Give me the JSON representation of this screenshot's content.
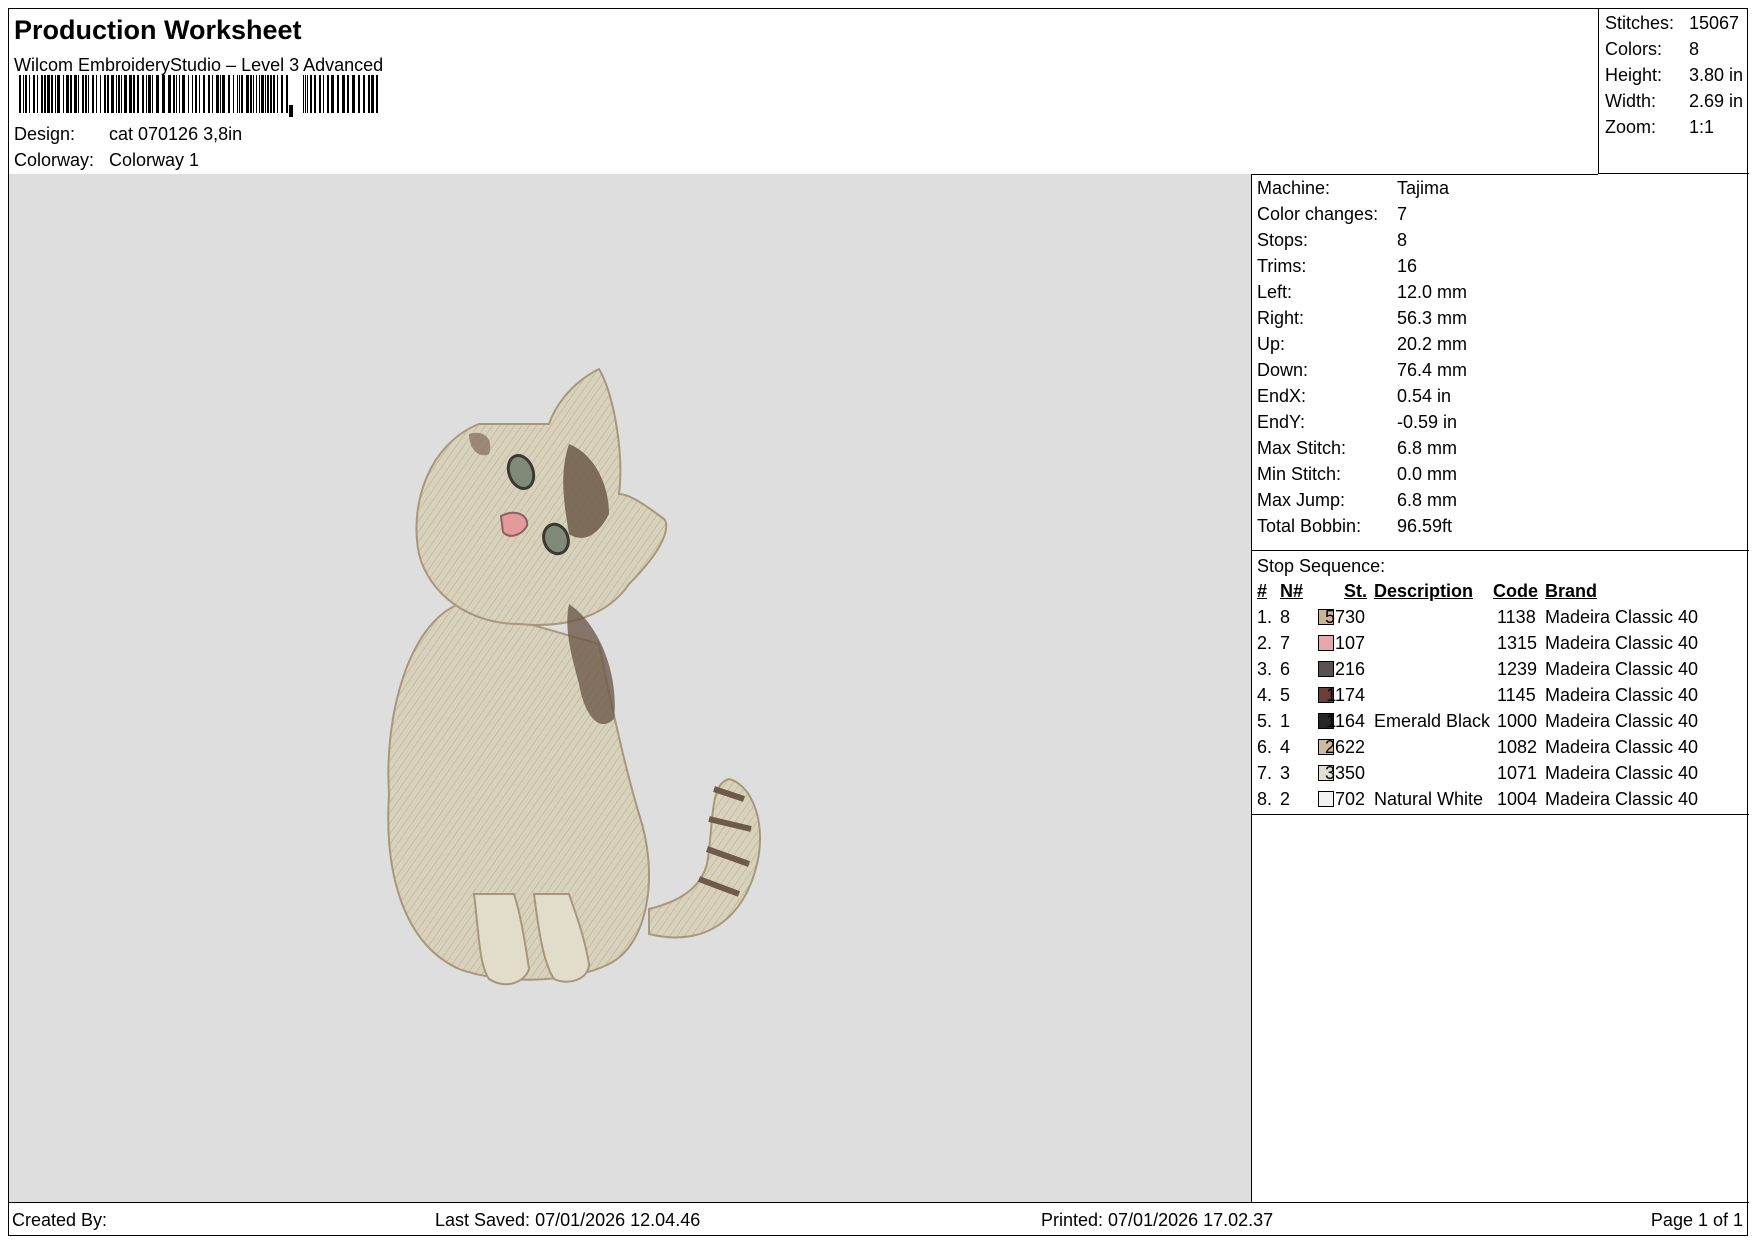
{
  "header": {
    "title": "Production Worksheet",
    "subtitle": "Wilcom EmbroideryStudio – Level 3 Advanced",
    "design_label": "Design:",
    "design_value": "cat 070126 3,8in",
    "colorway_label": "Colorway:",
    "colorway_value": "Colorway 1"
  },
  "summary": [
    {
      "label": "Stitches:",
      "value": "15067"
    },
    {
      "label": "Colors:",
      "value": "8"
    },
    {
      "label": "Height:",
      "value": "3.80 in"
    },
    {
      "label": "Width:",
      "value": "2.69 in"
    },
    {
      "label": "Zoom:",
      "value": "1:1"
    }
  ],
  "machine_info": [
    {
      "label": "Machine:",
      "value": "Tajima"
    },
    {
      "label": "Color changes:",
      "value": "7"
    },
    {
      "label": "Stops:",
      "value": "8"
    },
    {
      "label": "Trims:",
      "value": "16"
    },
    {
      "label": "Left:",
      "value": "12.0 mm"
    },
    {
      "label": "Right:",
      "value": "56.3 mm"
    },
    {
      "label": "Up:",
      "value": "20.2 mm"
    },
    {
      "label": "Down:",
      "value": "76.4 mm"
    },
    {
      "label": "EndX:",
      "value": "0.54 in"
    },
    {
      "label": "EndY:",
      "value": "-0.59 in"
    },
    {
      "label": "Max Stitch:",
      "value": "6.8 mm"
    },
    {
      "label": "Min Stitch:",
      "value": "0.0 mm"
    },
    {
      "label": "Max Jump:",
      "value": "6.8 mm"
    },
    {
      "label": "Total Bobbin:",
      "value": "96.59ft"
    }
  ],
  "stop_sequence": {
    "title": "Stop Sequence:",
    "headers": {
      "num": "#",
      "n": "N#",
      "st": "St.",
      "description": "Description",
      "code": "Code",
      "brand": "Brand"
    },
    "rows": [
      {
        "num": "1.",
        "n": "8",
        "color": "#c9b49a",
        "st": "5730",
        "description": "",
        "code": "1138",
        "brand": "Madeira Classic 40"
      },
      {
        "num": "2.",
        "n": "7",
        "color": "#e7a7ad",
        "st": "107",
        "description": "",
        "code": "1315",
        "brand": "Madeira Classic 40"
      },
      {
        "num": "3.",
        "n": "6",
        "color": "#5a5250",
        "st": "216",
        "description": "",
        "code": "1239",
        "brand": "Madeira Classic 40"
      },
      {
        "num": "4.",
        "n": "5",
        "color": "#6a4036",
        "st": "1174",
        "description": "",
        "code": "1145",
        "brand": "Madeira Classic 40"
      },
      {
        "num": "5.",
        "n": "1",
        "color": "#262626",
        "st": "1164",
        "description": "Emerald Black",
        "code": "1000",
        "brand": "Madeira Classic 40"
      },
      {
        "num": "6.",
        "n": "4",
        "color": "#cdb8a2",
        "st": "2622",
        "description": "",
        "code": "1082",
        "brand": "Madeira Classic 40"
      },
      {
        "num": "7.",
        "n": "3",
        "color": "#e3ddd4",
        "st": "3350",
        "description": "",
        "code": "1071",
        "brand": "Madeira Classic 40"
      },
      {
        "num": "8.",
        "n": "2",
        "color": "#f2f2f4",
        "st": "702",
        "description": "Natural White",
        "code": "1004",
        "brand": "Madeira Classic 40"
      }
    ]
  },
  "footer": {
    "created_by": "Created By:",
    "last_saved": "Last Saved: 07/01/2026 12.04.46",
    "printed": "Printed: 07/01/2026 17.02.37",
    "page": "Page 1 of 1"
  },
  "colors": {
    "preview_bg": "#dedede",
    "cat_body": "#d8d2bd",
    "cat_shade": "#bfae8f",
    "cat_dark": "#6e5a4a",
    "eye": "#7f8a78",
    "nose": "#e39a9a"
  }
}
